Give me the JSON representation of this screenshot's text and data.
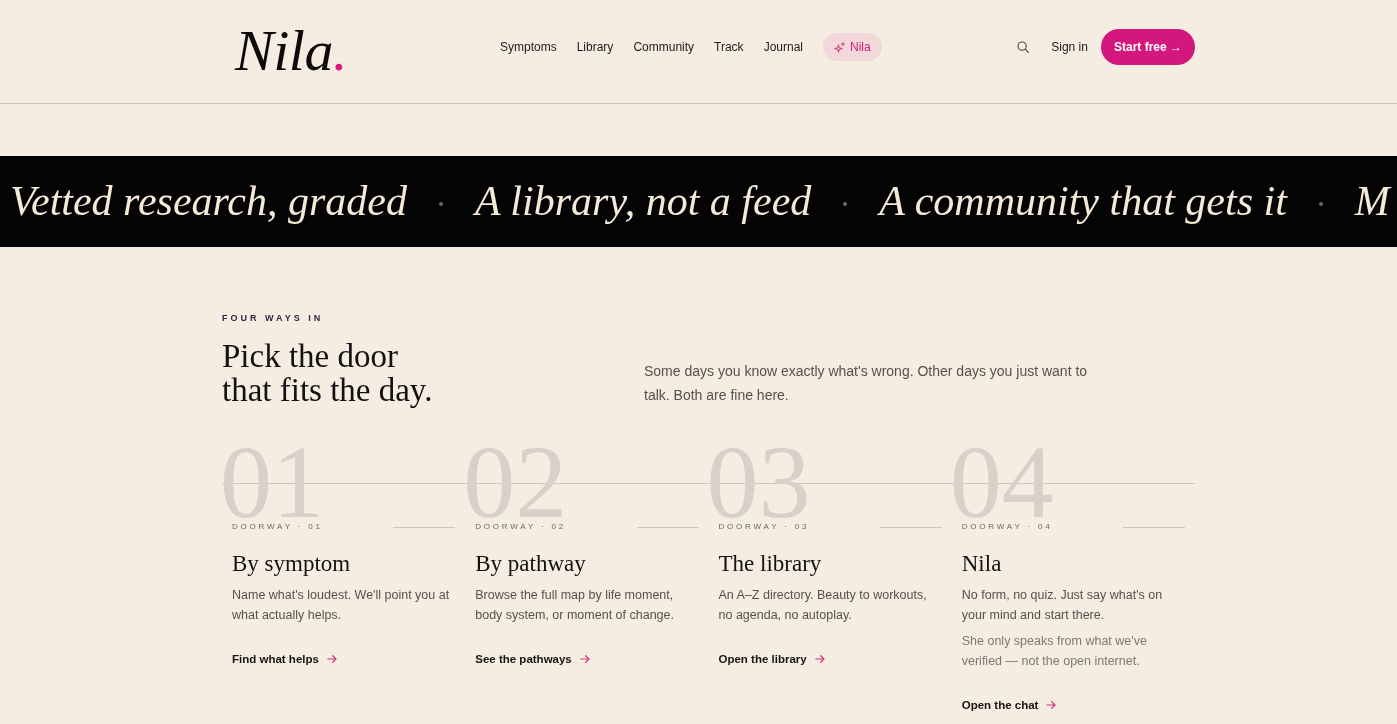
{
  "header": {
    "logo": {
      "text": "Nila",
      "mark": "."
    },
    "nav": [
      {
        "label": "Symptoms",
        "kind": "link"
      },
      {
        "label": "Library",
        "kind": "link"
      },
      {
        "label": "Community",
        "kind": "link"
      },
      {
        "label": "Track",
        "kind": "link"
      },
      {
        "label": "Journal",
        "kind": "link"
      },
      {
        "label": "Nila",
        "kind": "assistant"
      }
    ],
    "sign_in": "Sign in",
    "cta": "Start free →"
  },
  "marquee": {
    "items": [
      "Vetted research, graded",
      "A library, not a feed",
      "A community that gets it",
      "M"
    ]
  },
  "section": {
    "eyebrow": "FOUR WAYS IN",
    "heading": "Pick the door that fits the day.",
    "intro": "Some days you know exactly what's wrong. Other days you just want to talk. Both are fine here.",
    "doorways": [
      {
        "number": "01",
        "eyebrow": "DOORWAY · 01",
        "title": "By symptom",
        "description": "Name what's loudest. We'll point you at what actually helps.",
        "link": "Find what helps"
      },
      {
        "number": "02",
        "eyebrow": "DOORWAY · 02",
        "title": "By pathway",
        "description": "Browse the full map by life moment, body system, or moment of change.",
        "link": "See the pathways"
      },
      {
        "number": "03",
        "eyebrow": "DOORWAY · 03",
        "title": "The library",
        "description": "An A–Z directory. Beauty to workouts, no agenda, no autoplay.",
        "link": "Open the library"
      },
      {
        "number": "04",
        "eyebrow": "DOORWAY · 04",
        "title": "Nila",
        "description": "No form, no quiz. Just say what's on your mind and start there.",
        "note": "She only speaks from what we've verified — not the open internet.",
        "link": "Open the chat"
      }
    ]
  }
}
